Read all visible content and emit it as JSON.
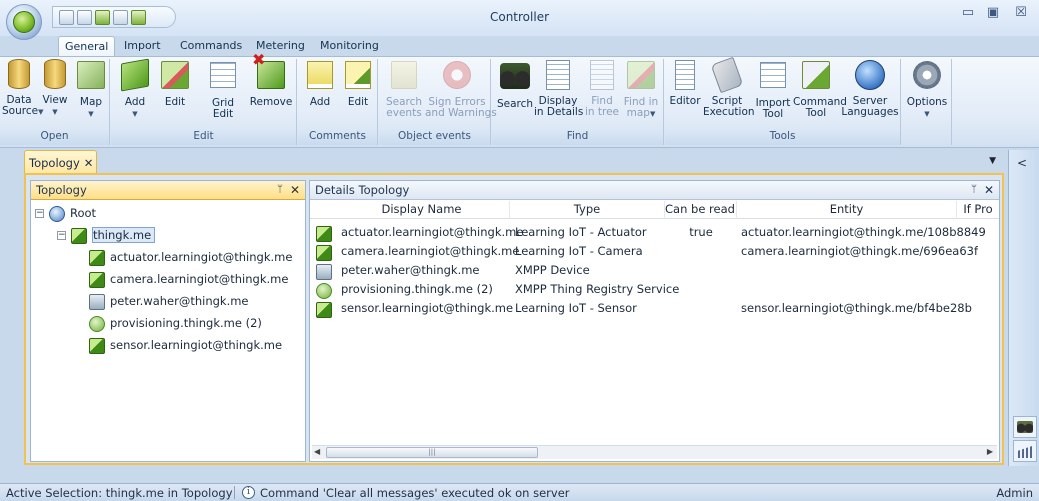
{
  "app": {
    "title": "Controller",
    "window_buttons": {
      "minimize": "▭",
      "maximize": "▣",
      "close": "☒"
    }
  },
  "ribbon_tabs": [
    {
      "label": "General",
      "active": true
    },
    {
      "label": "Import",
      "active": false
    },
    {
      "label": "Commands",
      "active": false
    },
    {
      "label": "Metering",
      "active": false
    },
    {
      "label": "Monitoring",
      "active": false
    }
  ],
  "ribbon": {
    "open": {
      "label": "Open",
      "data_source": "Data\nSource",
      "view": "View",
      "map": "Map"
    },
    "edit": {
      "label": "Edit",
      "add": "Add",
      "edit": "Edit",
      "grid_edit": "Grid\nEdit",
      "remove": "Remove"
    },
    "comments": {
      "label": "Comments",
      "add": "Add",
      "edit": "Edit"
    },
    "object_events": {
      "label": "Object events",
      "search_events": "Search\nevents",
      "sign_errors": "Sign Errors\nand Warnings"
    },
    "find": {
      "label": "Find",
      "search": "Search",
      "display_in_details": "Display\nin Details",
      "find_in_tree": "Find\nin tree",
      "find_in_map": "Find in\nmap"
    },
    "tools": {
      "label": "Tools",
      "editor": "Editor",
      "script_execution": "Script\nExecution",
      "import_tool": "Import\nTool",
      "command_tool": "Command\nTool",
      "server_languages": "Server\nLanguages"
    },
    "options": {
      "options": "Options"
    }
  },
  "document_tab": {
    "label": "Topology",
    "close": "✕"
  },
  "topology_pane": {
    "title": "Topology",
    "pin": "ᛘ",
    "close": "✕",
    "tree": {
      "root": "Root",
      "domain": "thingk.me",
      "children": [
        {
          "label": "actuator.learningiot@thingk.me",
          "icon": "green-device-icon"
        },
        {
          "label": "camera.learningiot@thingk.me",
          "icon": "green-device-icon"
        },
        {
          "label": "peter.waher@thingk.me",
          "icon": "xmpp-device-icon"
        },
        {
          "label": "provisioning.thingk.me (2)",
          "icon": "registry-cube-icon"
        },
        {
          "label": "sensor.learningiot@thingk.me",
          "icon": "green-device-icon"
        }
      ]
    }
  },
  "details_pane": {
    "title": "Details Topology",
    "pin": "ᛘ",
    "close": "✕",
    "columns": [
      "Display Name",
      "Type",
      "Can be read.",
      "Entity",
      "If Pro"
    ],
    "rows": [
      {
        "icon": "green-device-icon",
        "display_name": "actuator.learningiot@thingk.me",
        "type": "Learning IoT - Actuator",
        "can_be_read": "true",
        "entity": "actuator.learningiot@thingk.me/108b8849"
      },
      {
        "icon": "green-device-icon",
        "display_name": "camera.learningiot@thingk.me",
        "type": "Learning IoT - Camera",
        "can_be_read": "",
        "entity": "camera.learningiot@thingk.me/696ea63f"
      },
      {
        "icon": "xmpp-device-icon",
        "display_name": "peter.waher@thingk.me",
        "type": "XMPP Device",
        "can_be_read": "",
        "entity": ""
      },
      {
        "icon": "registry-cube-icon",
        "display_name": "provisioning.thingk.me (2)",
        "type": "XMPP Thing Registry Service",
        "can_be_read": "",
        "entity": ""
      },
      {
        "icon": "green-device-icon",
        "display_name": "sensor.learningiot@thingk.me",
        "type": "Learning IoT - Sensor",
        "can_be_read": "",
        "entity": "sensor.learningiot@thingk.me/bf4be28b"
      }
    ]
  },
  "status_bar": {
    "selection": "Active Selection: thingk.me in Topology",
    "info_icon": "i",
    "message": "Command 'Clear all messages' executed ok on server",
    "user": "Admin"
  }
}
